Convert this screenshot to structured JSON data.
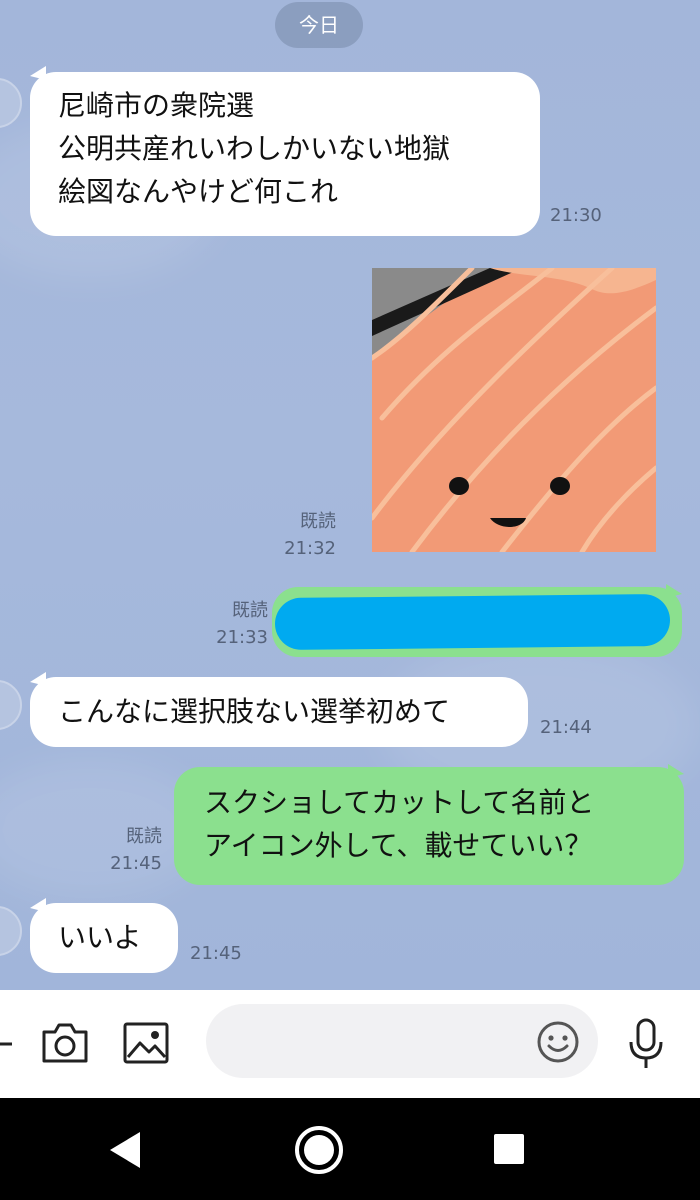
{
  "date_divider": "今日",
  "messages": [
    {
      "side": "in",
      "lines": [
        "尼崎市の衆院選",
        "公明共産れいわしかいない地獄",
        "絵図なんやけど何これ"
      ],
      "time": "21:30"
    },
    {
      "side": "out",
      "kind": "sticker",
      "read": "既読",
      "time": "21:32"
    },
    {
      "side": "out",
      "kind": "redacted",
      "read": "既読",
      "time": "21:33"
    },
    {
      "side": "in",
      "lines": [
        "こんなに選択肢ない選挙初めて"
      ],
      "time": "21:44"
    },
    {
      "side": "out",
      "lines": [
        "スクショしてカットして名前と",
        "アイコン外して、載せていい？"
      ],
      "read": "既読",
      "time": "21:45"
    },
    {
      "side": "in",
      "lines": [
        "いいよ"
      ],
      "time": "21:45"
    }
  ],
  "input_bar": {
    "placeholder": "",
    "icons": [
      "plus-icon",
      "camera-icon",
      "image-icon",
      "emoji-icon",
      "microphone-icon"
    ]
  },
  "nav": {
    "icons": [
      "back-icon",
      "home-icon",
      "recents-icon"
    ]
  },
  "colors": {
    "chat_background": "#a3b6da",
    "incoming_bubble": "#ffffff",
    "outgoing_bubble": "#8be08e",
    "redaction": "#00aaf0",
    "sticker_salmon": "#f29a76"
  }
}
